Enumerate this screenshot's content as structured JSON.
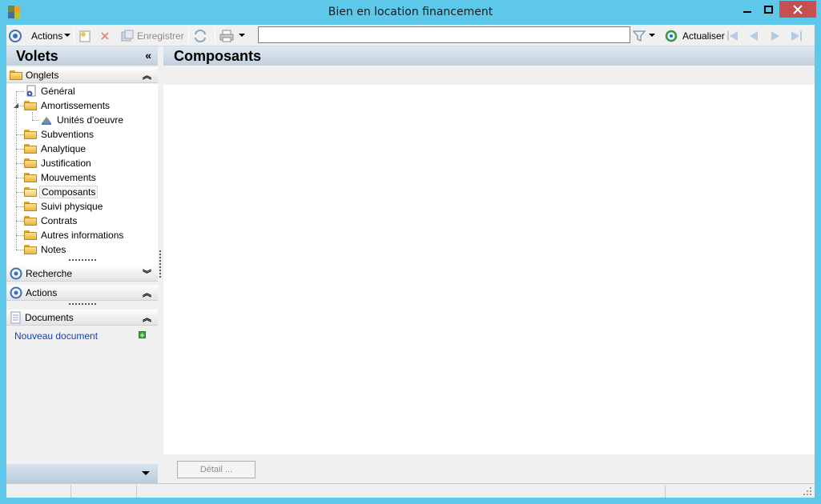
{
  "window": {
    "title": "Bien en location financement",
    "controls": [
      "minimize",
      "maximize",
      "close"
    ]
  },
  "toolbar": {
    "actions_label": "Actions",
    "save_label": "Enregistrer",
    "search_value": "",
    "refresh_label": "Actualiser"
  },
  "left_panel": {
    "title": "Volets",
    "onglets_label": "Onglets",
    "tree": [
      {
        "label": "Général",
        "level": 1,
        "icon": "gear-doc-icon"
      },
      {
        "label": "Amortissements",
        "level": 1,
        "icon": "folder-icon",
        "expanded": true
      },
      {
        "label": "Unités d'oeuvre",
        "level": 2,
        "icon": "units-icon"
      },
      {
        "label": "Subventions",
        "level": 1,
        "icon": "folder-icon"
      },
      {
        "label": "Analytique",
        "level": 1,
        "icon": "folder-icon"
      },
      {
        "label": "Justification",
        "level": 1,
        "icon": "folder-icon"
      },
      {
        "label": "Mouvements",
        "level": 1,
        "icon": "folder-icon"
      },
      {
        "label": "Composants",
        "level": 1,
        "icon": "folder-open-icon",
        "selected": true
      },
      {
        "label": "Suivi physique",
        "level": 1,
        "icon": "folder-icon"
      },
      {
        "label": "Contrats",
        "level": 1,
        "icon": "folder-icon"
      },
      {
        "label": "Autres informations",
        "level": 1,
        "icon": "folder-icon"
      },
      {
        "label": "Notes",
        "level": 1,
        "icon": "folder-icon"
      }
    ],
    "recherche_label": "Recherche",
    "actions_label": "Actions",
    "documents_label": "Documents",
    "new_document_label": "Nouveau document"
  },
  "main": {
    "title": "Composants",
    "detail_button": "Détail ..."
  },
  "colors": {
    "window_frame": "#5ec8ea",
    "close_button": "#c74f50",
    "header_gradient": "#c2d0de",
    "link": "#1a3fa8"
  }
}
